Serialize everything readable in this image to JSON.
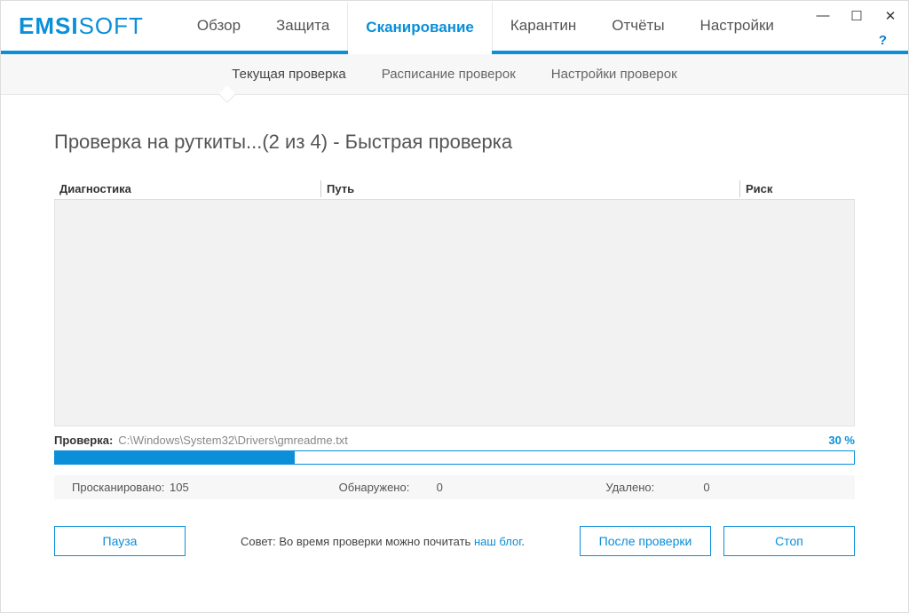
{
  "brand": {
    "a": "EMSI",
    "b": "SOFT"
  },
  "winctrl": {
    "min": "—",
    "max": "☐",
    "close": "✕"
  },
  "help": "?",
  "nav": {
    "items": [
      "Обзор",
      "Защита",
      "Сканирование",
      "Карантин",
      "Отчёты",
      "Настройки"
    ],
    "active_index": 2
  },
  "subnav": {
    "items": [
      "Текущая проверка",
      "Расписание проверок",
      "Настройки проверок"
    ],
    "active_index": 0
  },
  "title": "Проверка на руткиты...(2 из 4) - Быстрая проверка",
  "table": {
    "headers": {
      "diag": "Диагностика",
      "path": "Путь",
      "risk": "Риск"
    }
  },
  "progress": {
    "label": "Проверка:",
    "file": "C:\\Windows\\System32\\Drivers\\gmreadme.txt",
    "percent_text": "30 %",
    "percent": 30
  },
  "stats": {
    "scanned_label": "Просканировано:",
    "scanned_value": "105",
    "found_label": "Обнаружено:",
    "found_value": "0",
    "deleted_label": "Удалено:",
    "deleted_value": "0"
  },
  "buttons": {
    "pause": "Пауза",
    "after": "После проверки",
    "stop": "Стоп"
  },
  "tip": {
    "prefix": "Совет: Во время проверки можно почитать ",
    "link": "наш блог",
    "suffix": "."
  }
}
